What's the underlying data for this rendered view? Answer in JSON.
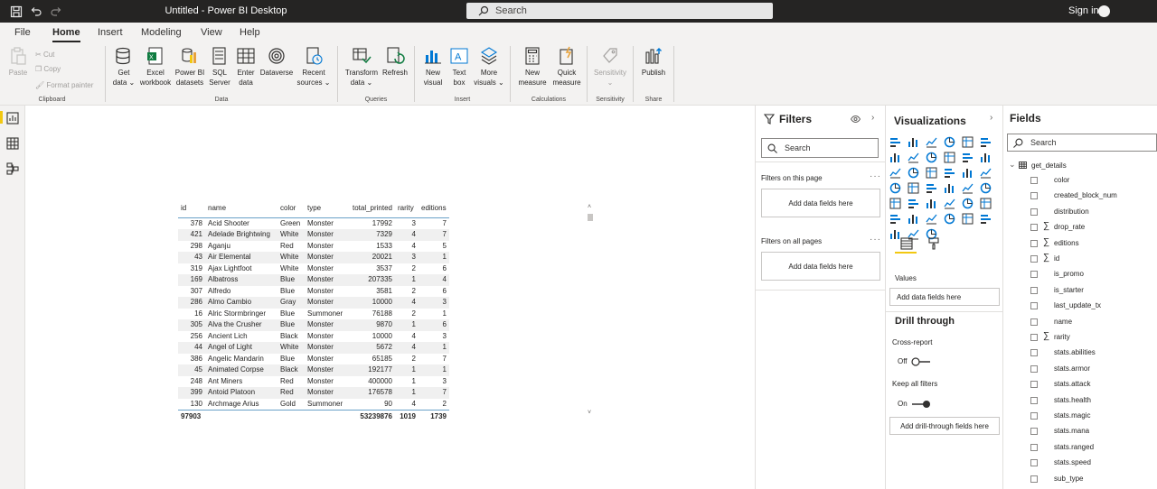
{
  "titlebar": {
    "title": "Untitled - Power BI Desktop",
    "search_placeholder": "Search",
    "signin": "Sign in"
  },
  "menu": [
    "File",
    "Home",
    "Insert",
    "Modeling",
    "View",
    "Help"
  ],
  "ribbon": {
    "clipboard": {
      "label": "Clipboard",
      "paste": "Paste",
      "cut": "Cut",
      "copy": "Copy",
      "format_painter": "Format painter"
    },
    "data": {
      "label": "Data",
      "buttons": [
        [
          "Get",
          "data ⌄"
        ],
        [
          "Excel",
          "workbook"
        ],
        [
          "Power BI",
          "datasets"
        ],
        [
          "SQL",
          "Server"
        ],
        [
          "Enter",
          "data"
        ],
        [
          "Dataverse",
          ""
        ],
        [
          "Recent",
          "sources ⌄"
        ]
      ]
    },
    "queries": {
      "label": "Queries",
      "buttons": [
        [
          "Transform",
          "data ⌄"
        ],
        [
          "Refresh",
          ""
        ]
      ]
    },
    "insert": {
      "label": "Insert",
      "buttons": [
        [
          "New",
          "visual"
        ],
        [
          "Text",
          "box"
        ],
        [
          "More",
          "visuals ⌄"
        ]
      ]
    },
    "calculations": {
      "label": "Calculations",
      "buttons": [
        [
          "New",
          "measure"
        ],
        [
          "Quick",
          "measure"
        ]
      ]
    },
    "sensitivity": {
      "label": "Sensitivity",
      "buttons": [
        [
          "Sensitivity",
          "⌄"
        ]
      ]
    },
    "share": {
      "label": "Share",
      "buttons": [
        [
          "Publish",
          ""
        ]
      ]
    }
  },
  "table": {
    "columns": [
      "id",
      "name",
      "color",
      "type",
      "total_printed",
      "rarity",
      "editions"
    ],
    "rows": [
      [
        "378",
        "Acid Shooter",
        "Green",
        "Monster",
        "17992",
        "3",
        "7"
      ],
      [
        "421",
        "Adelade Brightwing",
        "White",
        "Monster",
        "7329",
        "4",
        "7"
      ],
      [
        "298",
        "Aganju",
        "Red",
        "Monster",
        "1533",
        "4",
        "5"
      ],
      [
        "43",
        "Air Elemental",
        "White",
        "Monster",
        "20021",
        "3",
        "1"
      ],
      [
        "319",
        "Ajax Lightfoot",
        "White",
        "Monster",
        "3537",
        "2",
        "6"
      ],
      [
        "169",
        "Albatross",
        "Blue",
        "Monster",
        "207335",
        "1",
        "4"
      ],
      [
        "307",
        "Alfredo",
        "Blue",
        "Monster",
        "3581",
        "2",
        "6"
      ],
      [
        "286",
        "Almo Cambio",
        "Gray",
        "Monster",
        "10000",
        "4",
        "3"
      ],
      [
        "16",
        "Alric Stormbringer",
        "Blue",
        "Summoner",
        "76188",
        "2",
        "1"
      ],
      [
        "305",
        "Alva the Crusher",
        "Blue",
        "Monster",
        "9870",
        "1",
        "6"
      ],
      [
        "256",
        "Ancient Lich",
        "Black",
        "Monster",
        "10000",
        "4",
        "3"
      ],
      [
        "44",
        "Angel of Light",
        "White",
        "Monster",
        "5672",
        "4",
        "1"
      ],
      [
        "386",
        "Angelic Mandarin",
        "Blue",
        "Monster",
        "65185",
        "2",
        "7"
      ],
      [
        "45",
        "Animated Corpse",
        "Black",
        "Monster",
        "192177",
        "1",
        "1"
      ],
      [
        "248",
        "Ant Miners",
        "Red",
        "Monster",
        "400000",
        "1",
        "3"
      ],
      [
        "399",
        "Antoid Platoon",
        "Red",
        "Monster",
        "176578",
        "1",
        "7"
      ],
      [
        "130",
        "Archmage Arius",
        "Gold",
        "Summoner",
        "90",
        "4",
        "2"
      ]
    ],
    "totals": [
      "97903",
      "",
      "",
      "",
      "53239876",
      "1019",
      "1739"
    ]
  },
  "filters": {
    "title": "Filters",
    "search": "Search",
    "on_page": "Filters on this page",
    "on_all": "Filters on all pages",
    "add": "Add data fields here"
  },
  "viz": {
    "title": "Visualizations",
    "values": "Values",
    "add_fields": "Add data fields here",
    "drill": "Drill through",
    "cross": "Cross-report",
    "off": "Off",
    "keep": "Keep all filters",
    "on": "On",
    "add_drill": "Add drill-through fields here"
  },
  "fields": {
    "title": "Fields",
    "search": "Search",
    "table": "get_details",
    "items": [
      [
        "color",
        ""
      ],
      [
        "created_block_num",
        ""
      ],
      [
        "distribution",
        ""
      ],
      [
        "drop_rate",
        "∑"
      ],
      [
        "editions",
        "∑"
      ],
      [
        "id",
        "∑"
      ],
      [
        "is_promo",
        ""
      ],
      [
        "is_starter",
        ""
      ],
      [
        "last_update_tx",
        ""
      ],
      [
        "name",
        ""
      ],
      [
        "rarity",
        "∑"
      ],
      [
        "stats.abilities",
        ""
      ],
      [
        "stats.armor",
        ""
      ],
      [
        "stats.attack",
        ""
      ],
      [
        "stats.health",
        ""
      ],
      [
        "stats.magic",
        ""
      ],
      [
        "stats.mana",
        ""
      ],
      [
        "stats.ranged",
        ""
      ],
      [
        "stats.speed",
        ""
      ],
      [
        "sub_type",
        ""
      ]
    ]
  }
}
